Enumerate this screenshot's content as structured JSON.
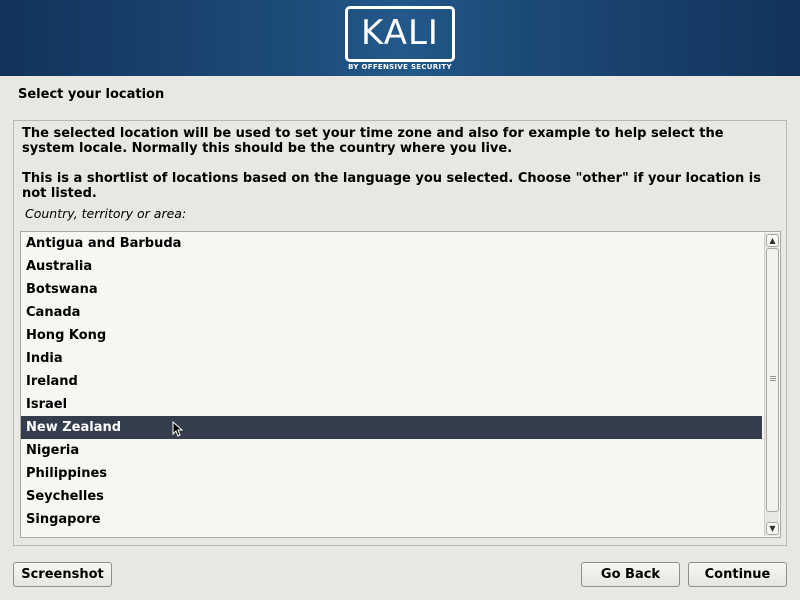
{
  "banner": {
    "logo_text": "KALI",
    "logo_subtitle": "BY OFFENSIVE SECURITY"
  },
  "step_title": "Select your location",
  "description": {
    "paragraph1": "The selected location will be used to set your time zone and also for example to help select the system locale. Normally this should be the country where you live.",
    "paragraph2": "This is a shortlist of locations based on the language you selected. Choose \"other\" if your location is not listed."
  },
  "list_label": "Country, territory or area:",
  "countries": [
    {
      "label": "Antigua and Barbuda",
      "selected": false
    },
    {
      "label": "Australia",
      "selected": false
    },
    {
      "label": "Botswana",
      "selected": false
    },
    {
      "label": "Canada",
      "selected": false
    },
    {
      "label": "Hong Kong",
      "selected": false
    },
    {
      "label": "India",
      "selected": false
    },
    {
      "label": "Ireland",
      "selected": false
    },
    {
      "label": "Israel",
      "selected": false
    },
    {
      "label": "New Zealand",
      "selected": true
    },
    {
      "label": "Nigeria",
      "selected": false
    },
    {
      "label": "Philippines",
      "selected": false
    },
    {
      "label": "Seychelles",
      "selected": false
    },
    {
      "label": "Singapore",
      "selected": false
    }
  ],
  "scrollbar": {
    "up_icon": "chevron-up-icon",
    "down_icon": "chevron-down-icon"
  },
  "buttons": {
    "screenshot": "Screenshot",
    "back": "Go Back",
    "continue": "Continue"
  },
  "colors": {
    "banner": "#1e4e7c",
    "selection": "#343d4c",
    "background": "#e8e7e1",
    "list_background": "#f6f6f2"
  }
}
